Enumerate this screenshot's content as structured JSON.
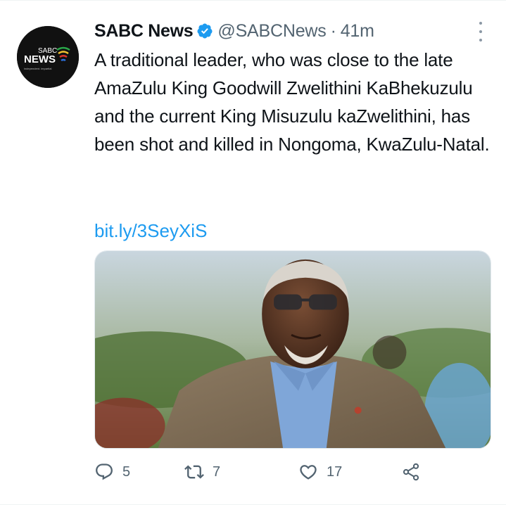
{
  "tweet": {
    "account": {
      "display_name": "SABC News",
      "handle": "@SABCNews",
      "separator": "·",
      "time": "41m",
      "verified": true,
      "avatar": {
        "brand_small": "SABC",
        "brand_large": "NEWS",
        "tagline": "independent. impartial"
      }
    },
    "text": "A traditional leader, who was close to the late AmaZulu King Goodwill Zwelithini KaBhekuzulu and the current King Misuzulu kaZwelithini, has been shot and killed in Nongoma, KwaZulu-Natal.",
    "link": "bit.ly/3SeyXiS",
    "actions": {
      "replies": "5",
      "retweets": "7",
      "likes": "17"
    },
    "icons": {
      "verified": "verified-badge-icon",
      "more": "more-options-icon",
      "reply": "reply-icon",
      "retweet": "retweet-icon",
      "like": "heart-icon",
      "share": "share-icon"
    },
    "colors": {
      "verified": "#1d9bf0",
      "link": "#1d9bf0",
      "text": "#0f1419",
      "secondary": "#536471"
    }
  }
}
